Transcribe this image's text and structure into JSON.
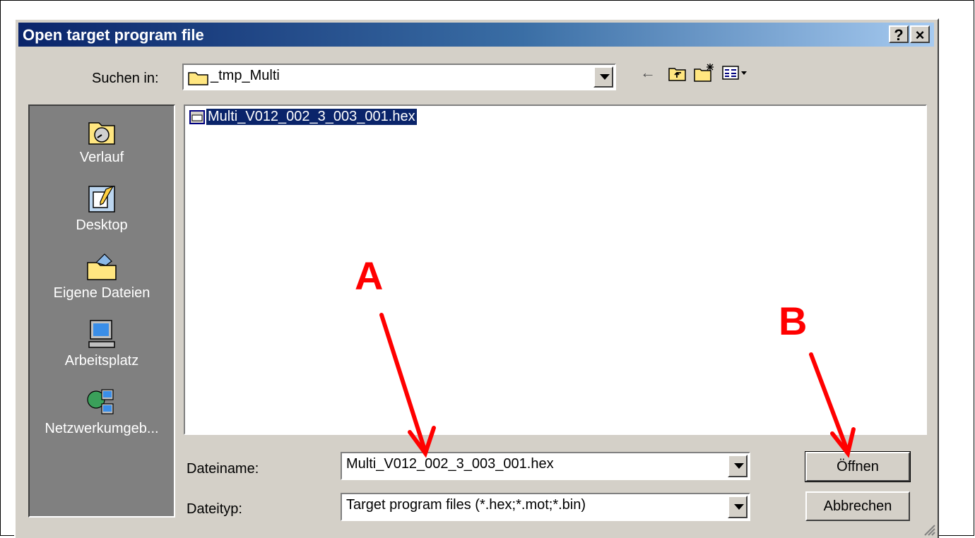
{
  "window": {
    "title": "Open target program file",
    "help_label": "?",
    "close_label": "×"
  },
  "lookin": {
    "label": "Suchen in:",
    "value": "_tmp_Multi"
  },
  "toolbar": {
    "back_icon": "←",
    "up_folder_icon": "folder-up-icon",
    "new_folder_icon": "new-folder-icon",
    "view_menu_icon": "view-menu-icon"
  },
  "places": [
    {
      "label": "Verlauf",
      "icon": "history-icon"
    },
    {
      "label": "Desktop",
      "icon": "desktop-icon"
    },
    {
      "label": "Eigene Dateien",
      "icon": "my-documents-icon"
    },
    {
      "label": "Arbeitsplatz",
      "icon": "my-computer-icon"
    },
    {
      "label": "Netzwerkumgeb...",
      "icon": "network-icon"
    }
  ],
  "files": [
    {
      "name": "Multi_V012_002_3_003_001.hex",
      "selected": true
    }
  ],
  "filename": {
    "label": "Dateiname:",
    "value": "Multi_V012_002_3_003_001.hex"
  },
  "filetype": {
    "label": "Dateityp:",
    "value": "Target program files (*.hex;*.mot;*.bin)"
  },
  "buttons": {
    "open": "Öffnen",
    "cancel": "Abbrechen"
  },
  "annotations": {
    "a": "A",
    "b": "B",
    "color": "#ff0000"
  }
}
